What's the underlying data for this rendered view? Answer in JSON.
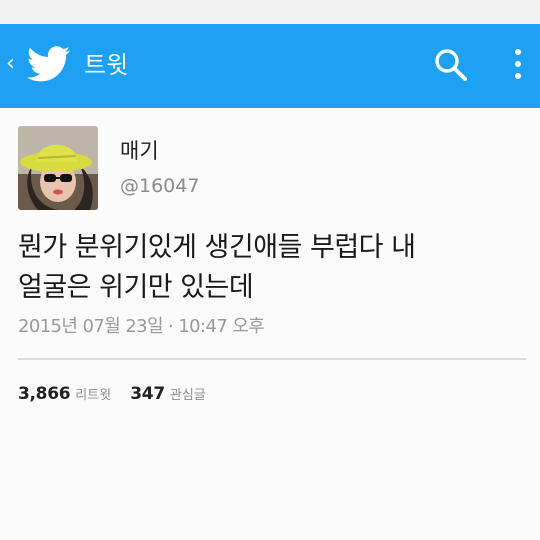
{
  "header": {
    "title": "트윗",
    "back_icon": "chevron-left-icon",
    "logo_icon": "twitter-bird-icon",
    "search_icon": "search-icon",
    "menu_icon": "more-vertical-icon",
    "accent_color": "#1ea1f2"
  },
  "tweet": {
    "author": {
      "display_name": "매기",
      "handle": "@16047"
    },
    "text_line1": "뭔가 분위기있게 생긴애들 부럽다 내",
    "text_line2": "얼굴은 위기만 있는데",
    "timestamp": "2015년 07월 23일 · 10:47 오후",
    "stats": {
      "retweets_count": "3,866",
      "retweets_label": "리트윗",
      "favorites_count": "347",
      "favorites_label": "관심글"
    }
  }
}
